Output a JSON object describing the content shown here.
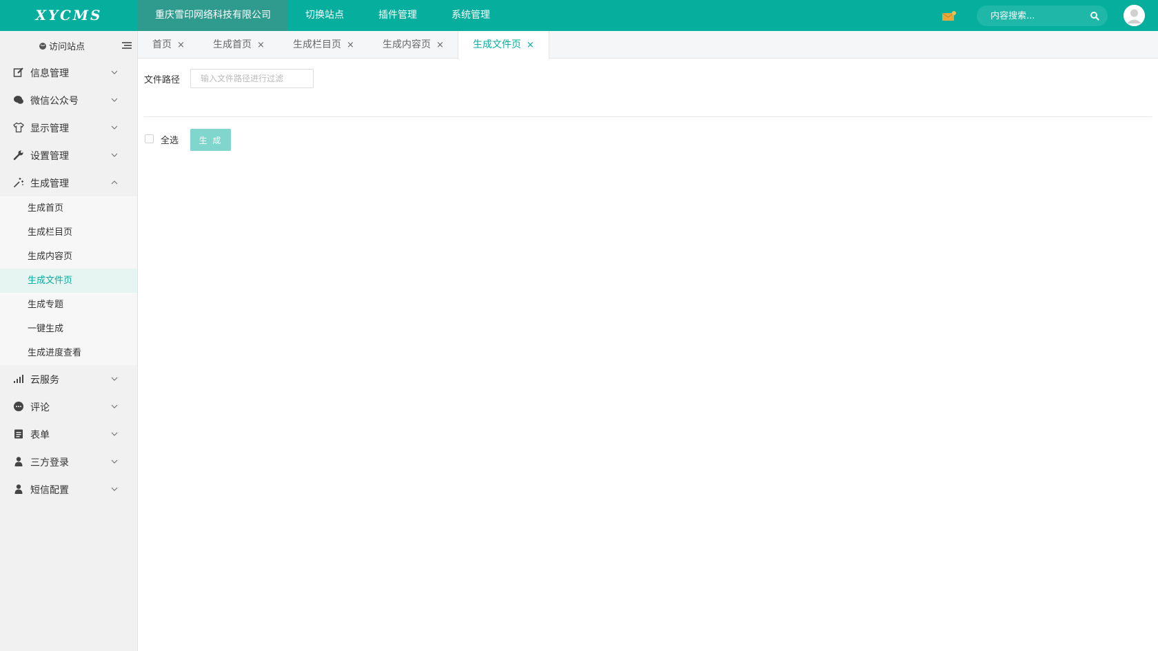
{
  "app": {
    "logo_text": "XYCMS"
  },
  "topnav": [
    {
      "label": "重庆雪印网络科技有限公司",
      "active": true
    },
    {
      "label": "切换站点",
      "active": false
    },
    {
      "label": "插件管理",
      "active": false
    },
    {
      "label": "系统管理",
      "active": false
    }
  ],
  "header": {
    "search_placeholder": "内容搜索...",
    "mail_icon": "mail-icon",
    "search_icon": "search-icon",
    "avatar_icon": "user-avatar-icon"
  },
  "sidebar": {
    "visit_label": "访问站点",
    "menu": [
      {
        "label": "信息管理",
        "icon": "edit-icon",
        "expanded": false
      },
      {
        "label": "微信公众号",
        "icon": "wechat-icon",
        "expanded": false
      },
      {
        "label": "显示管理",
        "icon": "shirt-icon",
        "expanded": false
      },
      {
        "label": "设置管理",
        "icon": "wrench-icon",
        "expanded": false
      },
      {
        "label": "生成管理",
        "icon": "magic-wand-icon",
        "expanded": true
      }
    ],
    "submenu": [
      {
        "label": "生成首页",
        "active": false
      },
      {
        "label": "生成栏目页",
        "active": false
      },
      {
        "label": "生成内容页",
        "active": false
      },
      {
        "label": "生成文件页",
        "active": true
      },
      {
        "label": "生成专题",
        "active": false
      },
      {
        "label": "一键生成",
        "active": false
      },
      {
        "label": "生成进度查看",
        "active": false
      }
    ],
    "menu_after": [
      {
        "label": "云服务",
        "icon": "signal-bars-icon"
      },
      {
        "label": "评论",
        "icon": "comment-icon"
      },
      {
        "label": "表单",
        "icon": "form-icon"
      },
      {
        "label": "三方登录",
        "icon": "user-icon"
      },
      {
        "label": "短信配置",
        "icon": "user-icon"
      }
    ]
  },
  "tabs": [
    {
      "label": "首页",
      "close": "×",
      "active": false
    },
    {
      "label": "生成首页",
      "close": "×",
      "active": false
    },
    {
      "label": "生成栏目页",
      "close": "×",
      "active": false
    },
    {
      "label": "生成内容页",
      "close": "×",
      "active": false
    },
    {
      "label": "生成文件页",
      "close": "×",
      "active": true
    }
  ],
  "main": {
    "filter_label": "文件路径",
    "filter_placeholder": "输入文件路径进行过滤",
    "filter_value": "",
    "select_all_label": "全选",
    "select_all_checked": false,
    "generate_button": "生 成"
  },
  "colors": {
    "primary": "#05ae9d",
    "primary_light": "#80d6cc",
    "mail_accent": "#e8a93c"
  }
}
